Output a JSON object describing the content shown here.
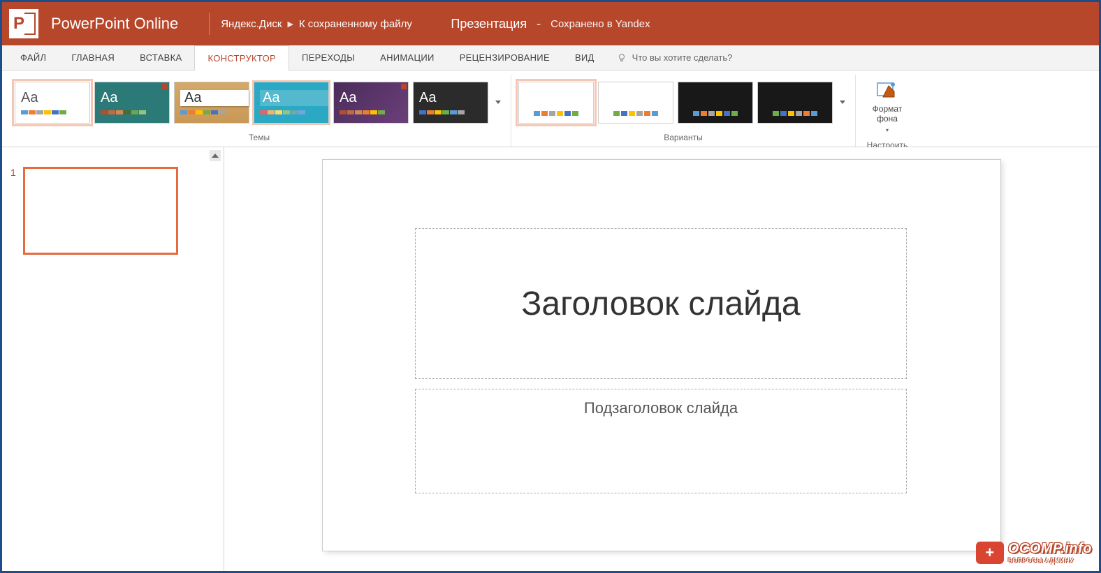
{
  "header": {
    "app_name": "PowerPoint Online",
    "breadcrumb_location": "Яндекс.Диск",
    "breadcrumb_file": "К сохраненному файлу",
    "document_name": "Презентация",
    "saved_status": "Сохранено в Yandex"
  },
  "ribbon_tabs": {
    "file": "ФАЙЛ",
    "home": "ГЛАВНАЯ",
    "insert": "ВСТАВКА",
    "design": "КОНСТРУКТОР",
    "transitions": "ПЕРЕХОДЫ",
    "animations": "АНИМАЦИИ",
    "review": "РЕЦЕНЗИРОВАНИЕ",
    "view": "ВИД",
    "tellme_placeholder": "Что вы хотите сделать?"
  },
  "ribbon_groups": {
    "themes": "Темы",
    "variants": "Варианты",
    "customize": "Настроить",
    "format_background": "Формат фона"
  },
  "slide_panel": {
    "slide_number": "1"
  },
  "slide": {
    "title_placeholder": "Заголовок слайда",
    "subtitle_placeholder": "Подзаголовок слайда"
  },
  "watermark": {
    "badge": "+",
    "main": "OCOMP.info",
    "sub": "ВОПРОСЫ АДМИНУ"
  }
}
